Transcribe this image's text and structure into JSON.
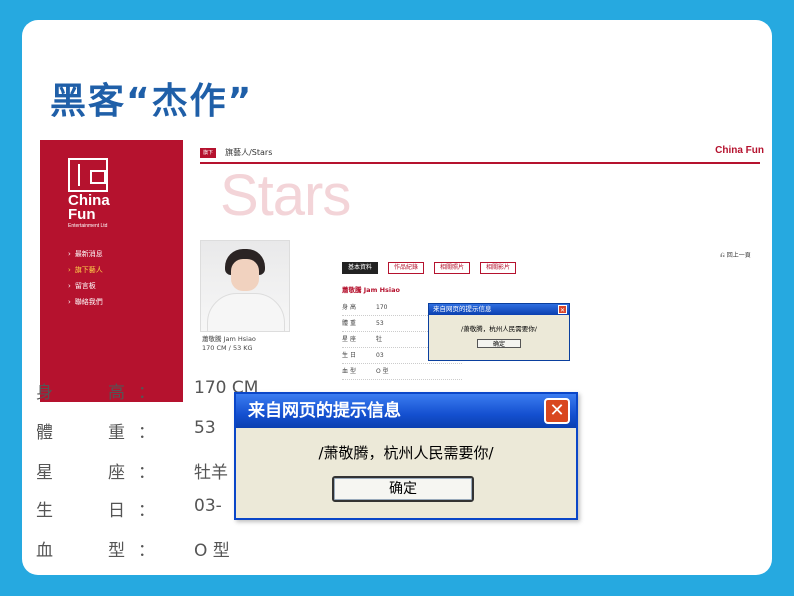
{
  "slide": {
    "title": "黑客“杰作”"
  },
  "site": {
    "logo_text": "China Fun",
    "logo_sub": "Entertainment Ltd",
    "menu": [
      {
        "label": "最新消息",
        "active": false
      },
      {
        "label": "旗下藝人",
        "active": true
      },
      {
        "label": "留言板",
        "active": false
      },
      {
        "label": "聯絡我們",
        "active": false
      }
    ],
    "header": {
      "badge": "旗下",
      "breadcrumb": "旗藝人/Stars",
      "logo": "China Fun"
    },
    "stars_watermark": "Stars",
    "back_link": "回上一頁",
    "tabs": [
      {
        "label": "基本資料",
        "active": true
      },
      {
        "label": "作品紀錄",
        "active": false
      },
      {
        "label": "相關照片",
        "active": false
      },
      {
        "label": "相關影片",
        "active": false
      }
    ],
    "profile_name": "蕭敬騰 Jam Hsiao",
    "photo_caption_name": "蕭敬騰 Jam Hsiao",
    "photo_caption_size": "170 CM / 53 KG",
    "rows": [
      {
        "key": "身高",
        "value": "170"
      },
      {
        "key": "體重",
        "value": "53"
      },
      {
        "key": "星座",
        "value": "牡"
      },
      {
        "key": "生日",
        "value": "03"
      },
      {
        "key": "血型",
        "value": "O 型"
      }
    ],
    "mini_dialog": {
      "title": "来自网页的提示信息",
      "message": "/萧敬腾，杭州人民需要你/",
      "ok": "确定"
    }
  },
  "zoom": {
    "rows": [
      {
        "k1": "身",
        "k2": "高",
        "colon": "：",
        "value": "170 CM"
      },
      {
        "k1": "體",
        "k2": "重",
        "colon": "：",
        "value": "53"
      },
      {
        "k1": "星",
        "k2": "座",
        "colon": "：",
        "value": "牡羊"
      },
      {
        "k1": "生",
        "k2": "日",
        "colon": "：",
        "value": "03-"
      },
      {
        "k1": "血",
        "k2": "型",
        "colon": "：",
        "value": "O 型"
      }
    ],
    "dialog": {
      "title": "来自网页的提示信息",
      "close": "✕",
      "message": "/萧敬腾，杭州人民需要你/",
      "ok": "确定"
    }
  }
}
